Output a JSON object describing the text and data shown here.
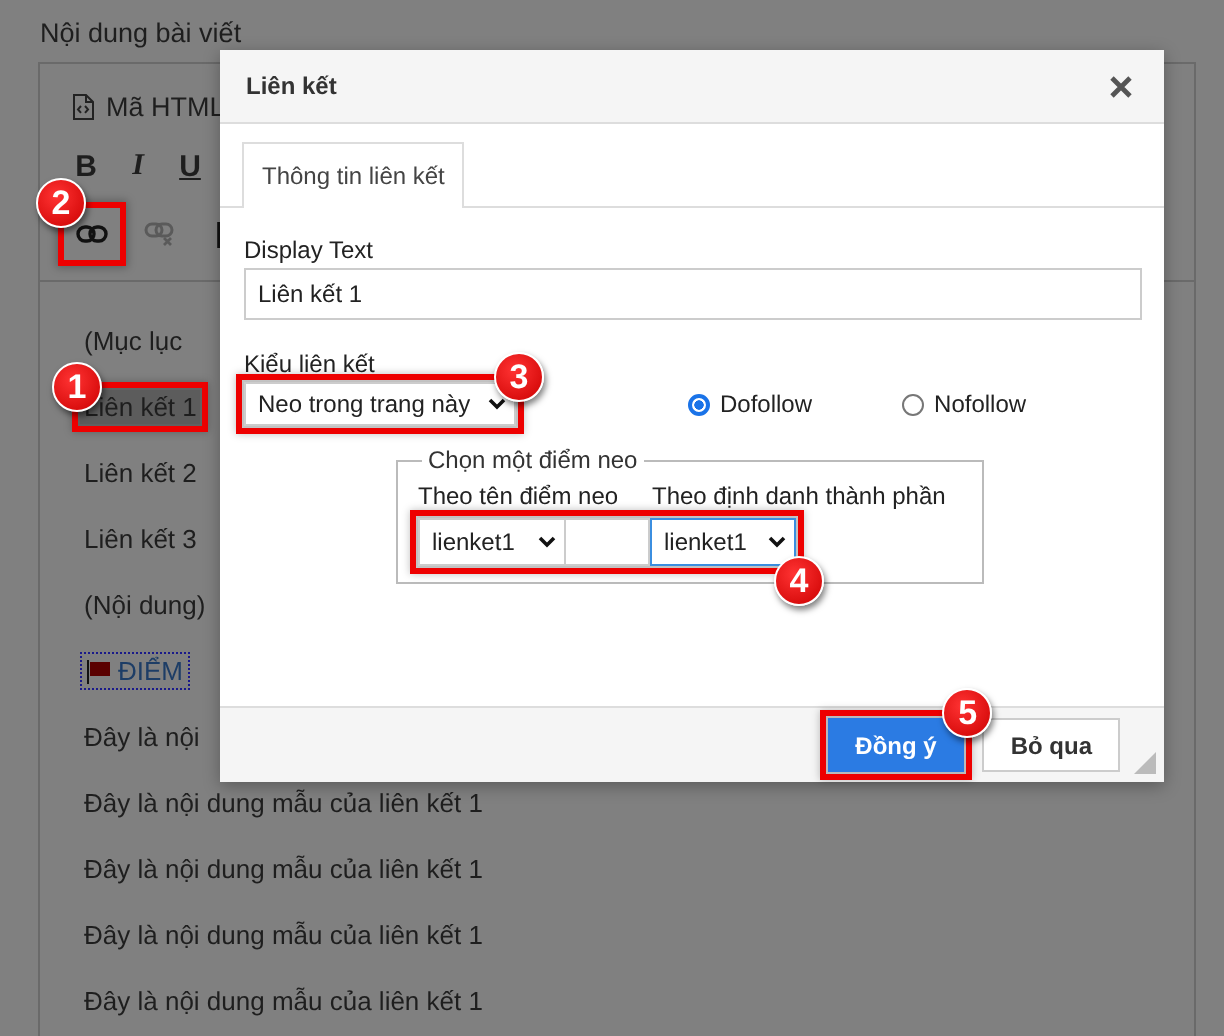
{
  "page": {
    "heading": "Nội dung bài viết"
  },
  "editor": {
    "source_button": {
      "label": "Mã HTML"
    },
    "format_buttons": [
      {
        "kind": "bold",
        "label": "B"
      },
      {
        "kind": "italic",
        "label": "I"
      },
      {
        "kind": "underline",
        "label": "U"
      }
    ],
    "tools": [
      {
        "kind": "link",
        "disabled": false,
        "callout": {
          "number": "2"
        }
      },
      {
        "kind": "unlink",
        "disabled": true
      },
      {
        "kind": "anchor",
        "disabled": false
      }
    ],
    "lines": [
      {
        "kind": "text",
        "text": "(Mục lục",
        "selected": false
      },
      {
        "kind": "text",
        "text": "Liên kết 1",
        "selected": true,
        "callout": {
          "number": "1"
        }
      },
      {
        "kind": "text",
        "text": "Liên kết 2",
        "selected": false
      },
      {
        "kind": "text",
        "text": "Liên kết 3",
        "selected": false
      },
      {
        "kind": "text",
        "text": "(Nội dung)",
        "selected": false
      },
      {
        "kind": "anchor",
        "text": "ĐIỂM",
        "selected": false
      },
      {
        "kind": "text",
        "text": "Đây là nội",
        "selected": false
      },
      {
        "kind": "text",
        "text": "Đây là nội dung mẫu của liên kết 1",
        "selected": false
      },
      {
        "kind": "text",
        "text": "Đây là nội dung mẫu của liên kết 1",
        "selected": false
      },
      {
        "kind": "text",
        "text": "Đây là nội dung mẫu của liên kết 1",
        "selected": false
      },
      {
        "kind": "text",
        "text": "Đây là nội dung mẫu của liên kết 1",
        "selected": false
      }
    ]
  },
  "dialog": {
    "title": "Liên kết",
    "tabs": [
      {
        "label": "Thông tin liên kết",
        "selected": true
      }
    ],
    "display_text": {
      "label": "Display Text",
      "value": "Liên kết 1"
    },
    "link_type": {
      "label": "Kiểu liên kết",
      "value": "Neo trong trang này",
      "callout": {
        "number": "3"
      }
    },
    "follow_options": [
      {
        "label": "Dofollow",
        "selected": true
      },
      {
        "label": "Nofollow",
        "selected": false
      }
    ],
    "anchor_group": {
      "legend": "Chọn một điểm neo",
      "by_name_label": "Theo tên điểm neo",
      "by_id_label": "Theo định danh thành phần",
      "name_select": {
        "value": "lienket1"
      },
      "id_select": {
        "value": "lienket1",
        "focused": true
      },
      "callout": {
        "number": "4"
      }
    },
    "buttons": [
      {
        "kind": "primary",
        "label": "Đồng ý",
        "callout": {
          "number": "5"
        }
      },
      {
        "kind": "secondary",
        "label": "Bỏ qua"
      }
    ]
  }
}
